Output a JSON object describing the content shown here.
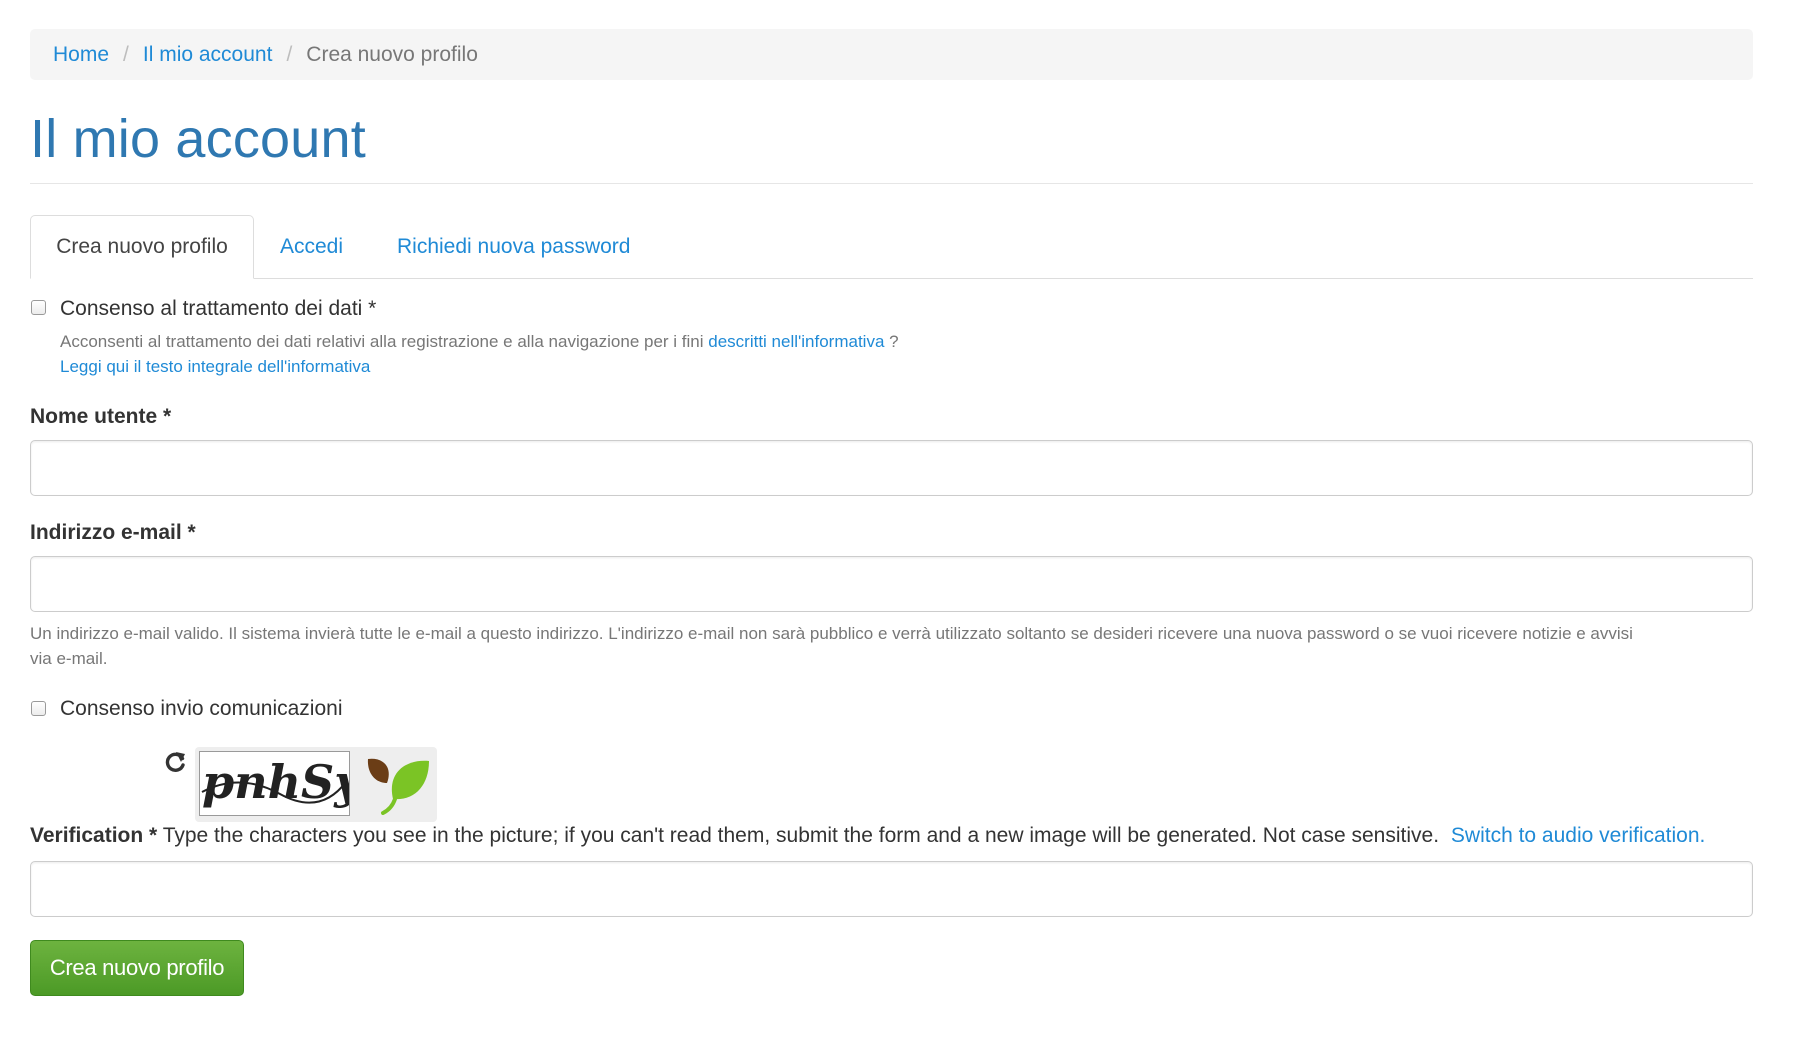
{
  "breadcrumb": {
    "home": "Home",
    "account": "Il mio account",
    "current": "Crea nuovo profilo",
    "separator": "/"
  },
  "page_title": "Il mio account",
  "tabs": [
    {
      "label": "Crea nuovo profilo",
      "active": true
    },
    {
      "label": "Accedi",
      "active": false
    },
    {
      "label": "Richiedi nuova password",
      "active": false
    }
  ],
  "consent_data": {
    "label": "Consenso al trattamento dei dati *",
    "checked": false,
    "help_text": "Acconsenti al trattamento dei dati relativi alla registrazione e alla navigazione per i fini",
    "help_link": "descritti nell'informativa",
    "help_suffix": "?",
    "full_text_link": "Leggi qui il testo integrale dell'informativa"
  },
  "username": {
    "label": "Nome utente *",
    "value": ""
  },
  "email": {
    "label": "Indirizzo e-mail *",
    "value": "",
    "help_line1": "Un indirizzo e-mail valido. Il sistema invierà tutte le e-mail a questo indirizzo. L'indirizzo e-mail non sarà pubblico e verrà utilizzato soltanto se desideri ricevere una nuova password o se vuoi ricevere notizie e avvisi",
    "help_line2": "via e-mail."
  },
  "consent_comms": {
    "label": "Consenso invio comunicazioni",
    "checked": false
  },
  "captcha": {
    "refresh_icon": "refresh-icon",
    "image_text": "pnhSy",
    "logo_icon": "leaf-logo-icon",
    "label": "Verification *",
    "instructions": "Type the characters you see in the picture; if you can't read them, submit the form and a new image will be generated. Not case sensitive.",
    "audio_link": "Switch to audio verification.",
    "value": ""
  },
  "submit": {
    "label": "Crea nuovo profilo"
  },
  "colors": {
    "link": "#1f8ad6",
    "title": "#2f78b1",
    "button": "#5aa832"
  }
}
